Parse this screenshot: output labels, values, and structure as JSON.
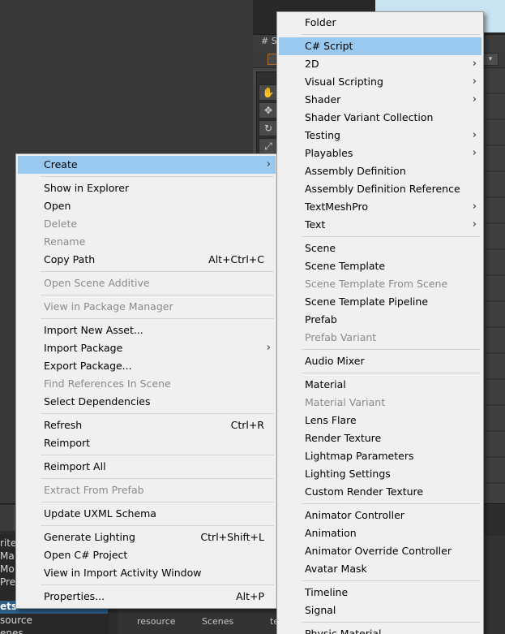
{
  "background": {
    "scene_tab_glyph": "# S",
    "dropdown_glyph": "▾",
    "tools": [
      {
        "name": "hand-tool-icon",
        "glyph": "✋"
      },
      {
        "name": "move-tool-icon",
        "glyph": "✥"
      },
      {
        "name": "rotate-tool-icon",
        "glyph": "↻"
      },
      {
        "name": "scale-tool-icon",
        "glyph": "⤢"
      }
    ],
    "project_items": [
      {
        "label": "rite",
        "selected": false
      },
      {
        "label": "Ma",
        "selected": false
      },
      {
        "label": "Mo",
        "selected": false
      },
      {
        "label": "Pre",
        "selected": false
      },
      {
        "label": "ets",
        "selected": true
      },
      {
        "label": "source",
        "selected": false
      },
      {
        "label": "enes",
        "selected": false
      }
    ],
    "thumb_labels": [
      "resource",
      "Scenes",
      "te"
    ]
  },
  "left_menu": [
    {
      "label": "Create",
      "submenu": true,
      "highlighted": true
    },
    {
      "sep": true
    },
    {
      "label": "Show in Explorer"
    },
    {
      "label": "Open"
    },
    {
      "label": "Delete",
      "disabled": true
    },
    {
      "label": "Rename",
      "disabled": true
    },
    {
      "label": "Copy Path",
      "shortcut": "Alt+Ctrl+C"
    },
    {
      "sep": true
    },
    {
      "label": "Open Scene Additive",
      "disabled": true
    },
    {
      "sep": true
    },
    {
      "label": "View in Package Manager",
      "disabled": true
    },
    {
      "sep": true
    },
    {
      "label": "Import New Asset..."
    },
    {
      "label": "Import Package",
      "submenu": true
    },
    {
      "label": "Export Package..."
    },
    {
      "label": "Find References In Scene",
      "disabled": true
    },
    {
      "label": "Select Dependencies"
    },
    {
      "sep": true
    },
    {
      "label": "Refresh",
      "shortcut": "Ctrl+R"
    },
    {
      "label": "Reimport"
    },
    {
      "sep": true
    },
    {
      "label": "Reimport All"
    },
    {
      "sep": true
    },
    {
      "label": "Extract From Prefab",
      "disabled": true
    },
    {
      "sep": true
    },
    {
      "label": "Update UXML Schema"
    },
    {
      "sep": true
    },
    {
      "label": "Generate Lighting",
      "shortcut": "Ctrl+Shift+L"
    },
    {
      "label": "Open C# Project"
    },
    {
      "label": "View in Import Activity Window"
    },
    {
      "sep": true
    },
    {
      "label": "Properties...",
      "shortcut": "Alt+P"
    }
  ],
  "right_menu": [
    {
      "label": "Folder"
    },
    {
      "sep": true
    },
    {
      "label": "C# Script",
      "highlighted": true
    },
    {
      "label": "2D",
      "submenu": true
    },
    {
      "label": "Visual Scripting",
      "submenu": true
    },
    {
      "label": "Shader",
      "submenu": true
    },
    {
      "label": "Shader Variant Collection"
    },
    {
      "label": "Testing",
      "submenu": true
    },
    {
      "label": "Playables",
      "submenu": true
    },
    {
      "label": "Assembly Definition"
    },
    {
      "label": "Assembly Definition Reference"
    },
    {
      "label": "TextMeshPro",
      "submenu": true
    },
    {
      "label": "Text",
      "submenu": true
    },
    {
      "sep": true
    },
    {
      "label": "Scene"
    },
    {
      "label": "Scene Template"
    },
    {
      "label": "Scene Template From Scene",
      "disabled": true
    },
    {
      "label": "Scene Template Pipeline"
    },
    {
      "label": "Prefab"
    },
    {
      "label": "Prefab Variant",
      "disabled": true
    },
    {
      "sep": true
    },
    {
      "label": "Audio Mixer"
    },
    {
      "sep": true
    },
    {
      "label": "Material"
    },
    {
      "label": "Material Variant",
      "disabled": true
    },
    {
      "label": "Lens Flare"
    },
    {
      "label": "Render Texture"
    },
    {
      "label": "Lightmap Parameters"
    },
    {
      "label": "Lighting Settings"
    },
    {
      "label": "Custom Render Texture"
    },
    {
      "sep": true
    },
    {
      "label": "Animator Controller"
    },
    {
      "label": "Animation"
    },
    {
      "label": "Animator Override Controller"
    },
    {
      "label": "Avatar Mask"
    },
    {
      "sep": true
    },
    {
      "label": "Timeline"
    },
    {
      "label": "Signal"
    },
    {
      "sep": true
    },
    {
      "label": "Physic Material"
    }
  ],
  "submenu_arrow": "›"
}
